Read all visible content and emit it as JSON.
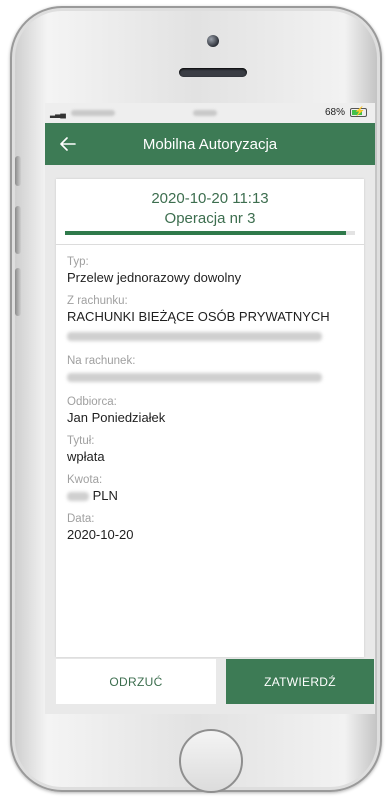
{
  "statusbar": {
    "battery_text": "68%"
  },
  "appbar": {
    "title": "Mobilna Autoryzacja"
  },
  "operation": {
    "datetime": "2020-10-20 11:13",
    "number_label": "Operacja nr 3",
    "progress": 0.97
  },
  "details": {
    "type_label": "Typ:",
    "type_value": "Przelew jednorazowy dowolny",
    "from_label": "Z rachunku:",
    "from_value": "RACHUNKI BIEŻĄCE OSÓB PRYWATNYCH",
    "to_label": "Na rachunek:",
    "recipient_label": "Odbiorca:",
    "recipient_value": "Jan Poniedziałek",
    "title_label": "Tytuł:",
    "title_value": "wpłata",
    "amount_label": "Kwota:",
    "amount_currency": "PLN",
    "date_label": "Data:",
    "date_value": "2020-10-20"
  },
  "actions": {
    "reject_label": "ODRZUĆ",
    "confirm_label": "ZATWIERDŹ"
  },
  "colors": {
    "brand_green": "#3d7b55",
    "text_green": "#3d6e4f"
  },
  "icons": {
    "back": "arrow-left-icon"
  }
}
